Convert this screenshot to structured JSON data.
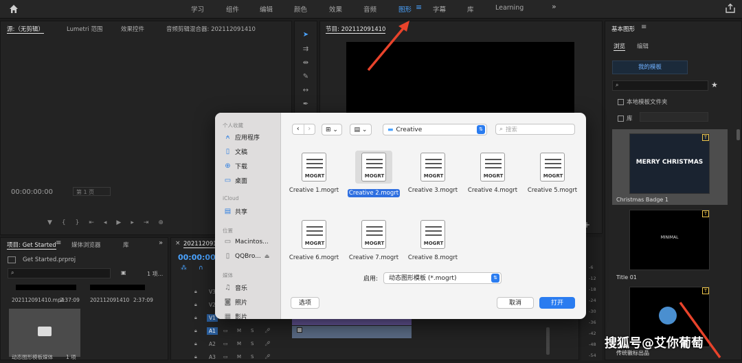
{
  "workspaces": [
    "学习",
    "组件",
    "编辑",
    "颜色",
    "效果",
    "音频",
    "图形",
    "字幕",
    "库",
    "Learning"
  ],
  "active_workspace": "图形",
  "source_panel": {
    "tabs": [
      "源:（无剪辑）",
      "Lumetri 范围",
      "效果控件",
      "音频剪辑混合器: 202112091410"
    ],
    "timecode": "00:00:00:00",
    "page": "第 1 页"
  },
  "program_panel": {
    "title": "节目: 202112091410"
  },
  "project_panel": {
    "tabs": [
      "项目: Get Started",
      "媒体浏览器",
      "库"
    ],
    "file": "Get Started.prproj",
    "count": "1 项...",
    "items": [
      {
        "name": "202112091410.mp4",
        "dur": "2:37:09"
      },
      {
        "name": "202112091410",
        "dur": "2:37:09"
      }
    ],
    "bin": {
      "name": "动态图形模板媒体",
      "count": "1 项"
    }
  },
  "timeline": {
    "tab": "202112091410",
    "timecode": "00:00:00:",
    "tracks": [
      "V3",
      "V2",
      "V1",
      "A1",
      "A2",
      "A3"
    ]
  },
  "essential_graphics": {
    "title": "基本图形",
    "tabs": [
      "浏览",
      "编辑"
    ],
    "my_templates": "我的模板",
    "local_folder": "本地模板文件夹",
    "library": "库",
    "templates": [
      {
        "name": "Christmas Badge 1",
        "text": "MERRY CHRISTMAS"
      },
      {
        "name": "Title 01",
        "text": "MINIMAL"
      },
      {
        "name": "传统徽标出品",
        "text": ""
      }
    ]
  },
  "meter_labels": [
    "-6",
    "-12",
    "-18",
    "-24",
    "-30",
    "-36",
    "-42",
    "-48",
    "-54"
  ],
  "dialog": {
    "favorites_header": "个人收藏",
    "favorites": [
      {
        "label": "应用程序",
        "icon": "app-icon"
      },
      {
        "label": "文稿",
        "icon": "doc-icon"
      },
      {
        "label": "下载",
        "icon": "download-icon"
      },
      {
        "label": "桌面",
        "icon": "desktop-icon"
      }
    ],
    "icloud_header": "iCloud",
    "icloud": [
      {
        "label": "共享",
        "icon": "shared-folder-icon"
      }
    ],
    "locations_header": "位置",
    "locations": [
      {
        "label": "Macintos...",
        "icon": "disk-icon"
      },
      {
        "label": "QQBro...",
        "icon": "disk-icon"
      }
    ],
    "media_header": "媒体",
    "media": [
      {
        "label": "音乐",
        "icon": "music-icon"
      },
      {
        "label": "照片",
        "icon": "camera-icon"
      },
      {
        "label": "影片",
        "icon": "film-icon"
      }
    ],
    "folder": "Creative",
    "search_placeholder": "搜索",
    "files": [
      "Creative 1.mogrt",
      "Creative 2.mogrt",
      "Creative 3.mogrt",
      "Creative 4.mogrt",
      "Creative 5.mogrt",
      "Creative 6.mogrt",
      "Creative 7.mogrt",
      "Creative 8.mogrt"
    ],
    "selected_file": "Creative 2.mogrt",
    "file_badge": "MOGRT",
    "enable_label": "启用:",
    "filter": "动态图形模板 (*.mogrt)",
    "options_button": "选项",
    "cancel_button": "取消",
    "open_button": "打开"
  },
  "watermark": "搜狐号@艾你葡萄",
  "colors": {
    "accent": "#4aa3ff",
    "primary_button": "#2a7cf0",
    "arrow": "#e8432b"
  }
}
